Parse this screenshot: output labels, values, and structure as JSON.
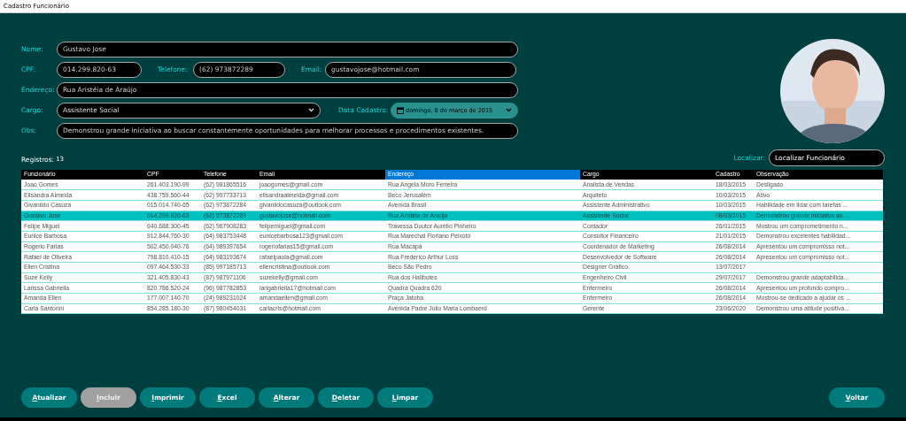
{
  "window": {
    "title": "Cadastro Funcionário"
  },
  "form_rows": [
    [
      {
        "kind": "text",
        "label": "Nome:",
        "value": "Gustavo Jose"
      }
    ],
    [
      {
        "kind": "text",
        "label": "CPF:",
        "value": "014.299.820-63"
      },
      {
        "kind": "text",
        "label": "Telefone:",
        "value": "(62) 973872289"
      },
      {
        "kind": "text",
        "label": "Email:",
        "value": "gustavojose@hotmail.com"
      }
    ],
    [
      {
        "kind": "text",
        "label": "Endereço:",
        "value": "Rua Aristéia de Araújo"
      }
    ],
    [
      {
        "kind": "select",
        "label": "Cargo:",
        "value": "Assistente Social"
      },
      {
        "kind": "date",
        "label": "Data Cadastro:",
        "value": "domingo, 8 de março de 2015"
      }
    ],
    [
      {
        "kind": "text",
        "label": "Obs:",
        "value": "Demonstrou grande iniciativa ao buscar constantemente oportunidades para melhorar processos e procedimentos existentes."
      }
    ]
  ],
  "photo": {
    "kind": "picture"
  },
  "records": {
    "label": "Registros:",
    "count": "13"
  },
  "search": {
    "label": "Localizar:",
    "value": "Localizar Funcionário"
  },
  "table": {
    "columns": [
      {
        "label": "Funcionário",
        "selected": false
      },
      {
        "label": "CPF",
        "selected": false
      },
      {
        "label": "Telefone",
        "selected": false
      },
      {
        "label": "Email",
        "selected": false
      },
      {
        "label": "Endereço",
        "selected": true
      },
      {
        "label": "Cargo",
        "selected": false
      },
      {
        "label": "Cadastro",
        "selected": false
      },
      {
        "label": "Observação",
        "selected": false
      }
    ],
    "rows": [
      {
        "selected": false,
        "cells": [
          "Joao Gomes",
          "261.403.190-99",
          "(62) 981865516",
          "joaogomes@gmail.com",
          "Rua Angela Moro Ferreira",
          "Analista de Vendas",
          "18/03/2015",
          "Desligado"
        ]
      },
      {
        "selected": false,
        "cells": [
          "Elisandra Almeida",
          "438.759.560-44",
          "(62) 997733713",
          "elisandraalmeida@gmail.com",
          "Beco Jerusalém",
          "Arquiteto",
          "10/03/2015",
          "Ativo"
        ]
      },
      {
        "selected": false,
        "cells": [
          "Givanildo Casuza",
          "015.014.740-65",
          "(62) 973872284",
          "givanildocasuza@outlook.com",
          "Avenida Brasil",
          "Assistente Administrativo",
          "10/03/2015",
          "Habilidade em lidar com tarefas ..."
        ]
      },
      {
        "selected": true,
        "cells": [
          "Gustavo Jose",
          "014.299.820-63",
          "(62) 973872289",
          "gustavojose@hotmail.com",
          "Rua Aristéia de Araújo",
          "Assistente Social",
          "08/03/2015",
          "Demonstrou grande iniciativa ao ..."
        ]
      },
      {
        "selected": false,
        "cells": [
          "Felipe Miguel",
          "640.688.300-45",
          "(62) 967908283",
          "felipemiguel@gmail.com",
          "Travessa Doutor Aurélio Pinheiro",
          "Contador",
          "26/01/2015",
          "Mostrou um comprometimento n..."
        ]
      },
      {
        "selected": false,
        "cells": [
          "Eunice Barbosa",
          "912.844.760-30",
          "(64) 983753448",
          "eunicebarbosa123@gmail.com",
          "Rua Marechal Floriano Peixoto",
          "Consultor Financeiro",
          "21/01/2015",
          "Demonstrou excelentes habilidad..."
        ]
      },
      {
        "selected": false,
        "cells": [
          "Rogerio Farias",
          "502.450.040-76",
          "(64) 989397654",
          "rogeriofarias15@gmail.com",
          "Rua Macapá",
          "Coordenador de Marketing",
          "26/08/2014",
          "Apresentou um compromisso not..."
        ]
      },
      {
        "selected": false,
        "cells": [
          "Rafael de Oliveira",
          "798.810.410-15",
          "(64) 983193674",
          "rafaelpaola@gmail.com",
          "Rua Frederico Arthur Loss",
          "Desenvolvedor de Software",
          "26/08/2014",
          "Apresentou um compromisso not..."
        ]
      },
      {
        "selected": false,
        "cells": [
          "Ellen Cristina",
          "097.464.530-33",
          "(85) 997185713",
          "ellencristina@outlook.com",
          "Beco São Pedro",
          "Designer Gráfico",
          "13/07/2017",
          null
        ]
      },
      {
        "selected": false,
        "cells": [
          "Suze Kelly",
          "321.405.830-43",
          "(87) 987971106",
          "suzekelly@gmail.com",
          "Rua dos Halibutes",
          "Engenheiro Civil",
          "29/07/2017",
          "Demonstrou grande adaptabilida..."
        ]
      },
      {
        "selected": false,
        "cells": [
          "Larissa Gabriella",
          "820.786.520-24",
          "(96) 987782853",
          "larigabriella17@hotmail.com",
          "Quadra Quadra 620",
          "Enfermeiro",
          "26/08/2014",
          "Apresentou um profundo compro..."
        ]
      },
      {
        "selected": false,
        "cells": [
          "Amanda Ellen",
          "177.007.140-70",
          "(24) 989231024",
          "amandaellen@gmail.com",
          "Praça Jatoba",
          "Enfermeiro",
          "26/08/2014",
          "Mostrou-se dedicado a ajudar os ..."
        ]
      },
      {
        "selected": false,
        "cells": [
          "Carla Santorini",
          "854.285.180-30",
          "(87) 980454031",
          "carlacris@hotmail.com",
          "Avenida Padre Júlio Maria Lombaerd",
          "Gerente",
          "23/06/2020",
          "Demonstrou uma atitude positiva..."
        ]
      }
    ]
  },
  "buttons": [
    {
      "label": "Atualizar",
      "disabled": false
    },
    {
      "label": "Incluir",
      "disabled": true
    },
    {
      "label": "Imprimir",
      "disabled": false
    },
    {
      "label": "Excel",
      "disabled": false
    },
    {
      "label": "Alterar",
      "disabled": false
    },
    {
      "label": "Deletar",
      "disabled": false
    },
    {
      "label": "Limpar",
      "disabled": false
    }
  ],
  "back_button": {
    "label": "Voltar",
    "disabled": false
  }
}
